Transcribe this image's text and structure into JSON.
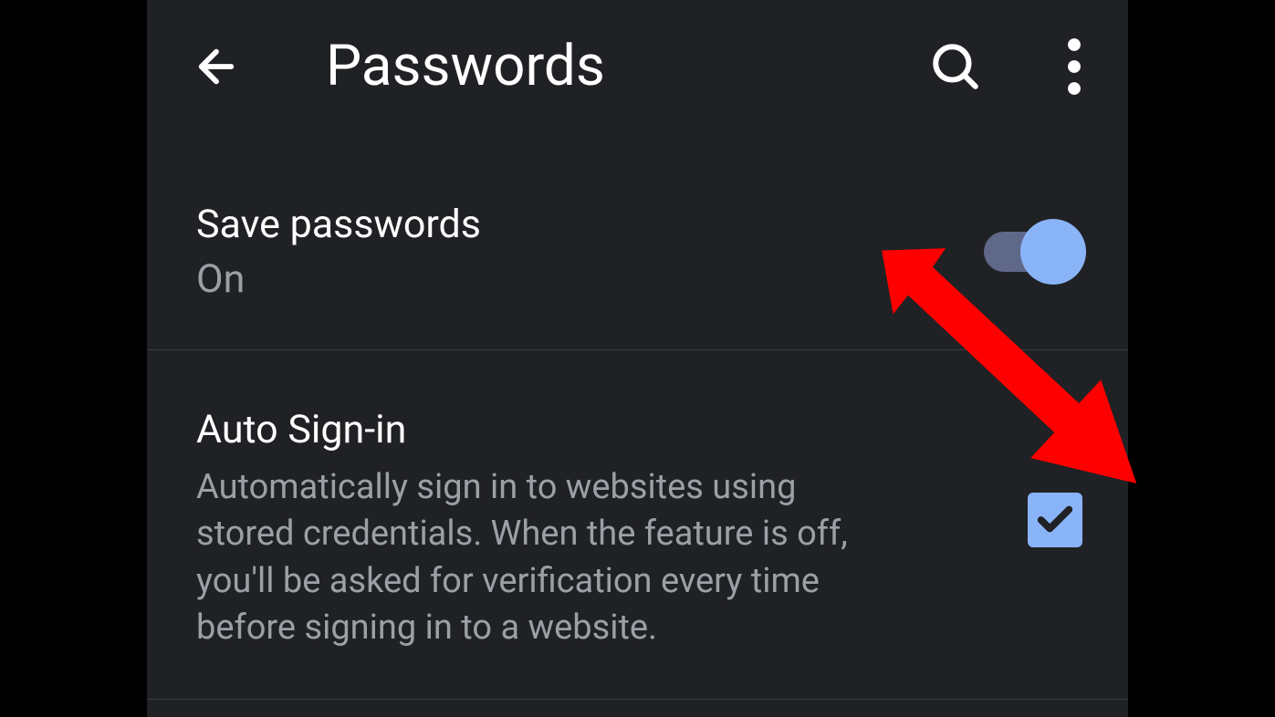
{
  "header": {
    "title": "Passwords"
  },
  "settings": {
    "savePasswords": {
      "label": "Save passwords",
      "status": "On",
      "enabled": true
    },
    "autoSignIn": {
      "label": "Auto Sign-in",
      "description": "Automatically sign in to websites using stored credentials. When the feature is off, you'll be asked for verification every time before signing in to a website.",
      "checked": true
    }
  }
}
